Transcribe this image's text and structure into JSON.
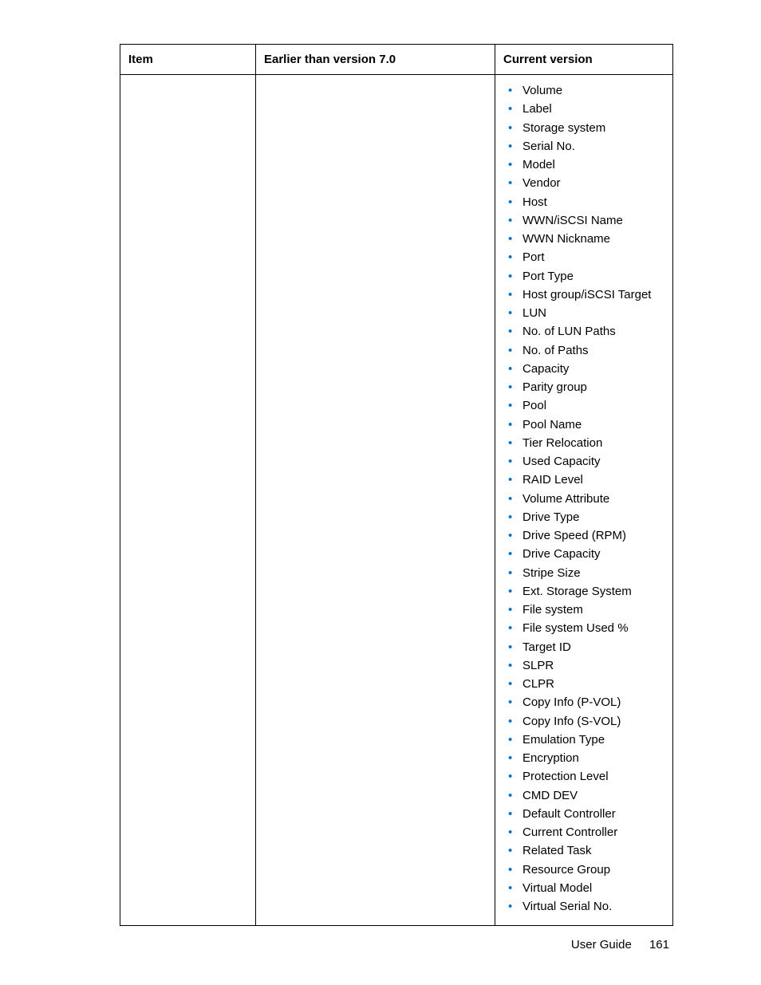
{
  "table": {
    "headers": {
      "item": "Item",
      "earlier": "Earlier than version 7.0",
      "current": "Current version"
    },
    "row": {
      "item": "",
      "earlier": "",
      "current_list": [
        "Volume",
        "Label",
        "Storage system",
        "Serial No.",
        "Model",
        "Vendor",
        "Host",
        "WWN/iSCSI Name",
        "WWN Nickname",
        "Port",
        "Port Type",
        "Host group/iSCSI Target",
        "LUN",
        "No. of LUN Paths",
        "No. of Paths",
        "Capacity",
        "Parity group",
        "Pool",
        "Pool Name",
        "Tier Relocation",
        "Used Capacity",
        "RAID Level",
        "Volume Attribute",
        "Drive Type",
        "Drive Speed (RPM)",
        "Drive Capacity",
        "Stripe Size",
        "Ext. Storage System",
        "File system",
        "File system Used %",
        "Target ID",
        "SLPR",
        "CLPR",
        "Copy Info (P-VOL)",
        "Copy Info (S-VOL)",
        "Emulation Type",
        "Encryption",
        "Protection Level",
        "CMD DEV",
        "Default Controller",
        "Current Controller",
        "Related Task",
        "Resource Group",
        "Virtual Model",
        "Virtual Serial No."
      ]
    }
  },
  "footer": {
    "label": "User Guide",
    "page": "161"
  }
}
